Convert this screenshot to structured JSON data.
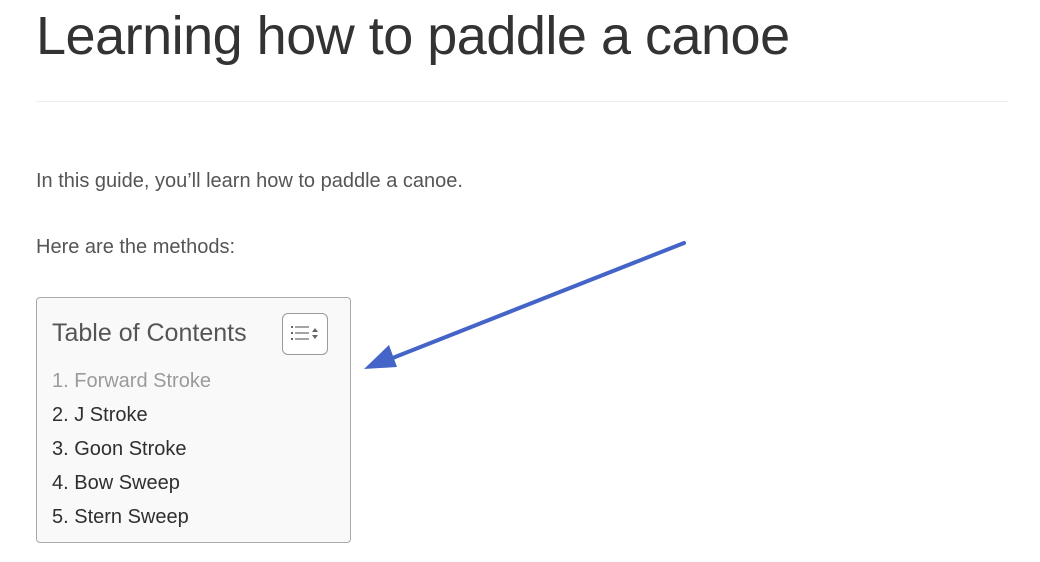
{
  "article": {
    "title": "Learning how to paddle a canoe",
    "intro": "In this guide, you’ll learn how to paddle a canoe.",
    "methods_heading": "Here are the methods:"
  },
  "toc": {
    "title": "Table of Contents",
    "toggle_icon": "list-toggle-icon",
    "items": [
      {
        "label": "1. Forward Stroke",
        "visited": true
      },
      {
        "label": "2. J Stroke",
        "visited": false
      },
      {
        "label": "3. Goon Stroke",
        "visited": false
      },
      {
        "label": "4. Bow Sweep",
        "visited": false
      },
      {
        "label": "5. Stern Sweep",
        "visited": false
      }
    ]
  },
  "annotation": {
    "arrow_color": "#4464c8",
    "arrow_icon": "arrow-icon"
  },
  "colors": {
    "text": "#555555",
    "title": "#333333",
    "visited_link": "#9b9b9b",
    "link": "#2f2f2f",
    "toc_background": "#f9f9f9"
  }
}
